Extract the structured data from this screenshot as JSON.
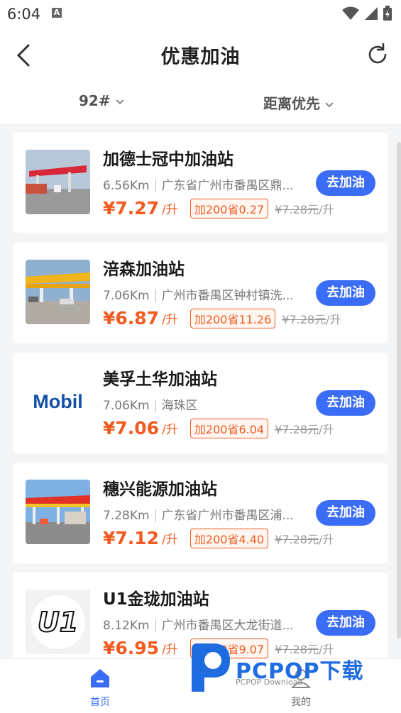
{
  "status_bar": {
    "time": "6:04",
    "notification_letter": "A"
  },
  "header": {
    "title": "优惠加油"
  },
  "filters": {
    "fuel": "92#",
    "sort": "距离优先"
  },
  "colors": {
    "accent": "#3b6cf6",
    "price": "#f25a1f"
  },
  "stations": [
    {
      "name": "加德士冠中加油站",
      "distance": "6.56Km",
      "address": "广东省广州市番禺区鼎...",
      "price": "¥7.27",
      "unit": "/升",
      "promo": "加200省0.27",
      "orig_price": "¥7.28元",
      "orig_unit": "/升",
      "button": "去加油"
    },
    {
      "name": "涪森加油站",
      "distance": "7.06Km",
      "address": "广州市番禺区钟村镇洗...",
      "price": "¥6.87",
      "unit": "/升",
      "promo": "加200省11.26",
      "orig_price": "¥7.28元",
      "orig_unit": "/升",
      "button": "去加油"
    },
    {
      "name": "美孚土华加油站",
      "distance": "7.06Km",
      "address": "海珠区",
      "price": "¥7.06",
      "unit": "/升",
      "promo": "加200省6.04",
      "orig_price": "¥7.28元",
      "orig_unit": "/升",
      "button": "去加油",
      "logo_text": "Mobil"
    },
    {
      "name": "穗兴能源加油站",
      "distance": "7.28Km",
      "address": "广东省广州市番禺区浦...",
      "price": "¥7.12",
      "unit": "/升",
      "promo": "加200省4.40",
      "orig_price": "¥7.28元",
      "orig_unit": "/升",
      "button": "去加油"
    },
    {
      "name": "U1金珑加油站",
      "distance": "8.12Km",
      "address": "广州市番禺区大龙街道...",
      "price": "¥6.95",
      "unit": "/升",
      "promo": "加200省9.07",
      "orig_price": "¥7.28元",
      "orig_unit": "/升",
      "button": "去加油",
      "logo_text": "U1"
    }
  ],
  "bottom_nav": [
    {
      "label": "首页",
      "icon": "home-icon",
      "active": true
    },
    {
      "label": "我的",
      "icon": "user-icon",
      "active": false
    }
  ],
  "watermark": {
    "text": "PCPOP下载",
    "sub": "PCPOP Download"
  }
}
